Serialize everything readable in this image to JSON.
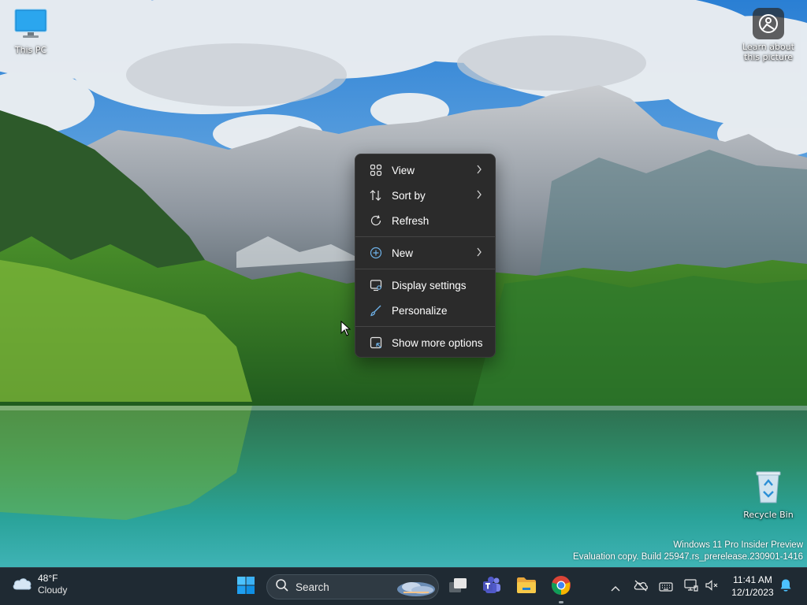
{
  "desktop": {
    "icons": {
      "this_pc": {
        "label": "This PC",
        "icon": "monitor-icon"
      },
      "learn": {
        "label": "Learn about this picture",
        "icon": "camera-info-icon"
      },
      "recycle_bin": {
        "label": "Recycle Bin",
        "icon": "recycle-bin-icon"
      }
    },
    "watermark": {
      "line1": "Windows 11 Pro Insider Preview",
      "line2": "Evaluation copy. Build 25947.rs_prerelease.230901-1416"
    }
  },
  "context_menu": {
    "items": [
      {
        "label": "View",
        "icon": "grid-icon",
        "submenu": true
      },
      {
        "label": "Sort by",
        "icon": "sort-icon",
        "submenu": true
      },
      {
        "label": "Refresh",
        "icon": "refresh-icon",
        "submenu": false
      },
      {
        "label": "New",
        "icon": "plus-circle-icon",
        "submenu": true
      },
      {
        "label": "Display settings",
        "icon": "display-icon",
        "submenu": false
      },
      {
        "label": "Personalize",
        "icon": "brush-icon",
        "submenu": false
      },
      {
        "label": "Show more options",
        "icon": "more-options-icon",
        "submenu": false
      }
    ]
  },
  "taskbar": {
    "weather": {
      "temp": "48°F",
      "condition": "Cloudy",
      "icon": "cloud-icon"
    },
    "search": {
      "placeholder": "Search"
    },
    "apps": [
      "start-icon",
      "task-view-icon",
      "teams-icon",
      "file-explorer-icon",
      "chrome-icon"
    ],
    "tray": [
      "chevron-up-icon",
      "onedrive-icon",
      "keyboard-icon",
      "network-icon",
      "volume-muted-icon"
    ],
    "clock": {
      "time": "11:41 AM",
      "date": "12/1/2023"
    },
    "notifications_icon": "bell-icon"
  },
  "colors": {
    "menu_bg": "#2b2b2b",
    "taskbar_bg": "#1f2a33",
    "accent": "#0078d4"
  }
}
